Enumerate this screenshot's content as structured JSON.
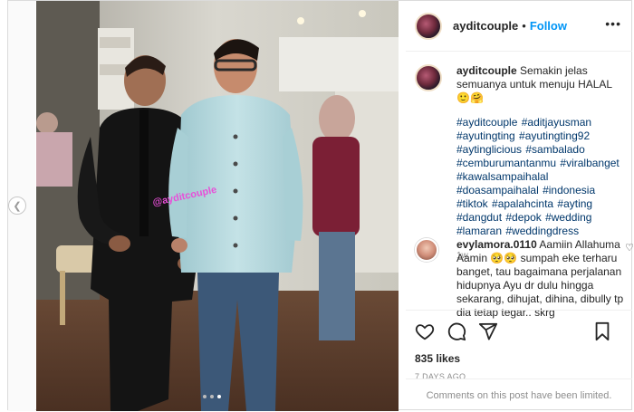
{
  "post": {
    "username": "ayditcouple",
    "follow_label": "Follow",
    "separator": "•",
    "more_label": "•••",
    "caption_text": "Semakin jelas semuanya untuk menuju HALAL🙂🤗",
    "hashtags": "#ayditcouple #aditjayusman #ayutingting #ayutingting92 #aytinglicious #sambalado #cemburumantanmu #viralbanget #kawalsampaihalal #doasampaihalal #indonesia #tiktok #apalahcinta #ayting #dangdut #depok #wedding #lamaran #weddingdress",
    "time_ago": "1w",
    "likes": "835 likes",
    "date": "7 DAYS AGO",
    "comments_limited": "Comments on this post have been limited."
  },
  "photo": {
    "watermark": "@ayditcouple"
  },
  "comment": {
    "username": "evylamora.0110",
    "text": "Aamiin Allahuma Aamin 🥺🥺 sumpah eke terharu banget, tau bagaimana perjalanan hidupnya Ayu dr dulu hingga sekarang, dihujat, dihina, dibully tp dia tetap tegar.. skrg"
  },
  "icons": {
    "like": "heart-icon",
    "comment": "comment-icon",
    "share": "share-icon",
    "save": "bookmark-icon",
    "prev": "chevron-left-icon"
  },
  "colors": {
    "link": "#0095f6",
    "hashtag": "#00376b",
    "text": "#262626",
    "muted": "#8e8e8e"
  }
}
